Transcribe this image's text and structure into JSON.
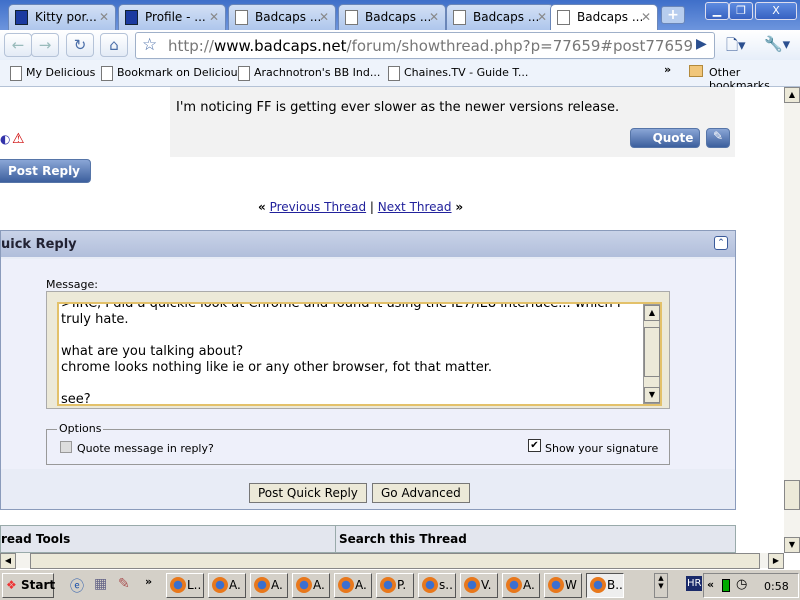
{
  "tabs": [
    {
      "label": "Kitty por..."
    },
    {
      "label": "Profile - ..."
    },
    {
      "label": "Badcaps ..."
    },
    {
      "label": "Badcaps ..."
    },
    {
      "label": "Badcaps ..."
    },
    {
      "label": "Badcaps ..."
    }
  ],
  "address": {
    "prefix": "http://",
    "domain": "www.badcaps.net",
    "path": "/forum/showthread.php?p=77659#post77659"
  },
  "bookmarks": [
    {
      "label": "My Delicious"
    },
    {
      "label": "Bookmark on Delicious"
    },
    {
      "label": "Arachnotron's BB  Ind..."
    },
    {
      "label": "Chaines.TV - Guide T..."
    }
  ],
  "bookmarks_more": "»",
  "other_bookmarks": "Other bookmarks",
  "post": {
    "text": "I'm noticing FF is getting ever slower as the newer versions release.",
    "quote_label": "Quote"
  },
  "post_reply_label": "Post Reply",
  "thread_nav": {
    "left": "«",
    "prev": "Previous Thread",
    "sep": "|",
    "next": "Next Thread",
    "right": "»"
  },
  "quick_reply": {
    "title": "uick Reply",
    "message_label": "Message:",
    "message": ">IIRC, I did a quickie look at Chrome and found it using the IE7/IE8 interface... which I\ntruly hate.\n\nwhat are you talking about?\nchrome looks nothing like ie or any other browser, fot that matter.\n\nsee?",
    "options_label": "Options",
    "quote_label": "Quote message in reply?",
    "signature_label": "Show your signature",
    "post_button": "Post Quick Reply",
    "advanced_button": "Go Advanced"
  },
  "thread_tools": "read Tools",
  "search_thread": "Search this Thread",
  "taskbar": {
    "start": "Start",
    "chevron": "»",
    "tasks": [
      "L..",
      "A.",
      "A.",
      "A.",
      "A.",
      "P.",
      "s..",
      "V.",
      "A.",
      "W",
      "B.."
    ],
    "lang": "HR",
    "tray_chevron": "«",
    "clock": "0:58"
  }
}
